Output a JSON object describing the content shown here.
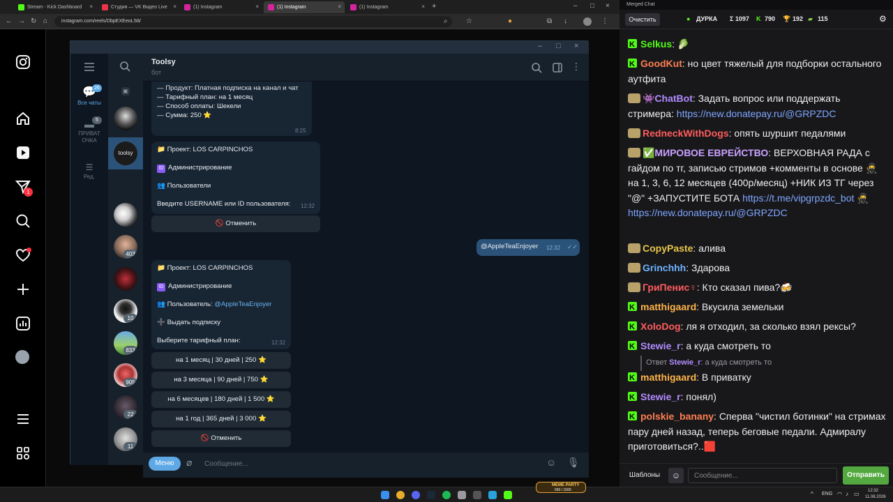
{
  "browser": {
    "tabs": [
      {
        "label": "Stream - Kick Dashboard",
        "color": "#53fc18"
      },
      {
        "label": "Студия — VK Видео Live",
        "color": "#e8334a"
      },
      {
        "label": "(1) Instagram",
        "color": "#d6249f"
      },
      {
        "label": "(1) Instagram",
        "color": "#d6249f"
      },
      {
        "label": "(1) Instagram",
        "color": "#d6249f"
      }
    ],
    "url": "instagram.com/reels/DbpEXEeoLS8/"
  },
  "instagram": {
    "notif_badge": "1",
    "icons": [
      "instagram-logo-icon",
      "home-icon",
      "reels-icon",
      "direct-icon",
      "search-icon",
      "heart-icon",
      "create-icon",
      "stats-icon",
      "profile-avatar",
      "menu-icon",
      "more-icon"
    ]
  },
  "telegram": {
    "folders": [
      {
        "label": "Все чаты",
        "badge": "26"
      },
      {
        "label": "ПРИВАТ ОЧКА",
        "badge": "5"
      },
      {
        "label": "Ред.",
        "badge": ""
      }
    ],
    "chatlist_badges": [
      "403",
      "10",
      "833",
      "905",
      "22",
      "11"
    ],
    "selected_chat_avatar_text": "toolsy",
    "chat_name": "Toolsy",
    "chat_status": "бот",
    "msg1": {
      "lines": [
        "— Продукт: Платная подписка на канал и чат",
        "— Тарифный план: на 1 месяц",
        "— Способ оплаты: Шекели",
        "— Сумма: 250 ⭐"
      ],
      "time": "8:25"
    },
    "msg2": {
      "project": "📁 Проект: LOS CARPINCHOS",
      "section": "Администрирование",
      "users": "👥 Пользователи",
      "prompt": "Введите USERNAME или ID пользователя:",
      "time": "12:32",
      "cancel": "🚫 Отменить"
    },
    "out_msg": {
      "text": "@AppleTeaEnjoyer",
      "time": "12:32"
    },
    "msg3": {
      "project": "📁 Проект: LOS CARPINCHOS",
      "section": "Администрирование",
      "user_label": "👥 Пользователь: ",
      "user_link": "@AppleTeaEnjoyer",
      "action": "➕ Выдать подписку",
      "prompt": "Выберите тарифный план:",
      "time": "12:32"
    },
    "plans": [
      "на 1 месяц | 30 дней | 250 ⭐",
      "на 3 месяца | 90 дней | 750 ⭐",
      "на 6 месяцев | 180 дней | 1 500 ⭐",
      "на 1 год | 365 дней | 3 000 ⭐"
    ],
    "cancel2": "🚫 Отменить",
    "menu_button": "Меню",
    "input_placeholder": "Сообщение..."
  },
  "chat_panel": {
    "title": "Merged Chat",
    "clear_button": "Очистить",
    "streamer": "ДУРКА",
    "stats": [
      {
        "label": "Σ 1097"
      },
      {
        "label": "790"
      },
      {
        "label": "192"
      },
      {
        "label": "115"
      }
    ],
    "messages": [
      {
        "platform": "kick",
        "user": "Selkus",
        "color": "#53fc18",
        "text": ": 🥬"
      },
      {
        "platform": "kick",
        "user": "GoodKut",
        "color": "#ff7f50",
        "text": ": но цвет тяжелый для подборки остального аутфита"
      },
      {
        "platform": "vk",
        "user": "👾ChatBot",
        "color": "#b28cff",
        "text": ": Задать вопрос или поддержать стримера: ",
        "link": "https://new.donatepay.ru/@GRPZDC"
      },
      {
        "platform": "vk",
        "user": "RedneckWithDogs",
        "color": "#ff5c5c",
        "text": ": опять шуршит педалями"
      },
      {
        "platform": "vk",
        "user": "✅МИРОВОЕ ЕВРЕЙСТВО",
        "color": "#c9a0ff",
        "text": ": ВЕРХОВНАЯ РАДА с гайдом по тг, записью стримов +комменты в основе 🥷 на 1, 3, 6, 12 месяцев (400р/месяц) +НИК ИЗ ТГ через \"@\" +ЗАПУСТИТЕ БОТА ",
        "link": "https://t.me/vipgrpzdc_bot 🥷 https://new.donatepay.ru/@GRPZDC"
      },
      {
        "platform": "vk",
        "user": "CopyPaste",
        "color": "#e8c54a",
        "text": ": алива"
      },
      {
        "platform": "vk",
        "user": "Grinchhh",
        "color": "#6fb3ff",
        "text": ": Здарова"
      },
      {
        "platform": "vk",
        "user": "ГриПенис♀",
        "color": "#ff5c5c",
        "text": ": Кто сказал пива?🍻"
      },
      {
        "platform": "kick",
        "user": "matthigaard",
        "color": "#ffb347",
        "text": ": Вкусила земельки"
      },
      {
        "platform": "kick",
        "user": "XoloDog",
        "color": "#ff5c5c",
        "text": ": ля я отходил, за сколько взял рексы?"
      },
      {
        "platform": "kick",
        "user": "Stewie_r",
        "color": "#b28cff",
        "text": ": а куда смотреть то"
      },
      {
        "platform": "reply",
        "prefix": "Ответ ",
        "user": "Stewie_r",
        "text": ": а куда смотреть то"
      },
      {
        "platform": "kick",
        "user": "matthigaard",
        "color": "#ffb347",
        "text": ": В приватку"
      },
      {
        "platform": "kick",
        "user": "Stewie_r",
        "color": "#b28cff",
        "text": ": понял)"
      },
      {
        "platform": "kick",
        "user": "polskie_banany",
        "color": "#ff7f50",
        "text": ": Сперва \"чистил ботинки\" на стримах пару дней назад, теперь беговые педали. Адмиралу приготовиться?..🟥"
      }
    ],
    "templates_button": "Шаблоны",
    "input_placeholder": "Сообщение...",
    "send_button": "Отправить"
  },
  "taskbar": {
    "lang": "ENG",
    "time": "12:32",
    "date": "11.08.2026",
    "game_title": "MEME PARTY",
    "game_counter": "550 / 1500"
  }
}
